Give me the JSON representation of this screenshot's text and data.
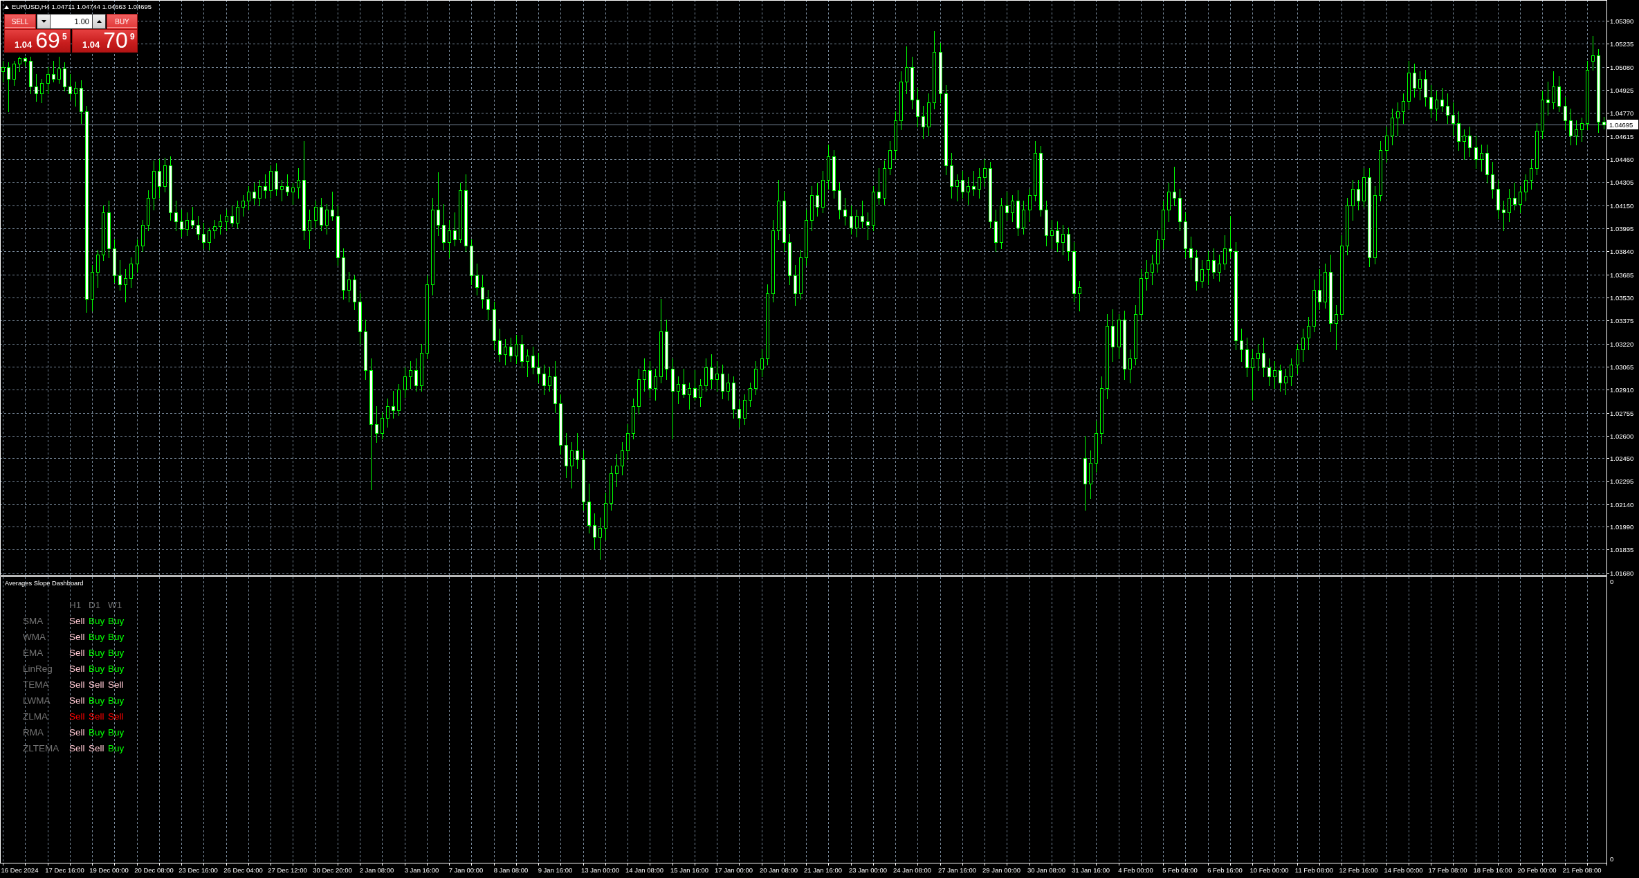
{
  "chart_header": {
    "symbol": "EURUSD,H4",
    "prices": [
      "1.04711",
      "1.04744",
      "1.04663",
      "1.04695"
    ]
  },
  "trade_panel": {
    "sell": {
      "label": "SELL",
      "big_figure": "1.04",
      "pips": "69",
      "fraction": "5"
    },
    "volume": "1.00",
    "buy": {
      "label": "BUY",
      "big_figure": "1.04",
      "pips": "70",
      "fraction": "9"
    }
  },
  "chart_data": [
    {
      "type": "candlestick",
      "color": "#00ff00",
      "grid": true,
      "ylim": [
        1.0166,
        1.0553
      ],
      "yticks": [
        {
          "value": 1.0539,
          "label": "1.05390"
        },
        {
          "value": 1.05235,
          "label": "1.05235"
        },
        {
          "value": 1.0508,
          "label": "1.05080"
        },
        {
          "value": 1.04925,
          "label": "1.04925"
        },
        {
          "value": 1.0477,
          "label": "1.04770"
        },
        {
          "value": 1.04615,
          "label": "1.04615"
        },
        {
          "value": 1.0446,
          "label": "1.04460"
        },
        {
          "value": 1.04305,
          "label": "1.04305"
        },
        {
          "value": 1.0415,
          "label": "1.04150"
        },
        {
          "value": 1.03995,
          "label": "1.03995"
        },
        {
          "value": 1.0384,
          "label": "1.03840"
        },
        {
          "value": 1.03685,
          "label": "1.03685"
        },
        {
          "value": 1.0353,
          "label": "1.03530"
        },
        {
          "value": 1.03375,
          "label": "1.03375"
        },
        {
          "value": 1.0322,
          "label": "1.03220"
        },
        {
          "value": 1.03065,
          "label": "1.03065"
        },
        {
          "value": 1.0291,
          "label": "1.02910"
        },
        {
          "value": 1.02755,
          "label": "1.02755"
        },
        {
          "value": 1.026,
          "label": "1.02600"
        },
        {
          "value": 1.0245,
          "label": "1.02450"
        },
        {
          "value": 1.02295,
          "label": "1.02295"
        },
        {
          "value": 1.0214,
          "label": "1.02140"
        },
        {
          "value": 1.0199,
          "label": "1.01990"
        },
        {
          "value": 1.01835,
          "label": "1.01835"
        },
        {
          "value": 1.0168,
          "label": "1.01680"
        }
      ],
      "ref_lines": [
        {
          "axis": "y",
          "value": 1.04695,
          "label": "1.04695",
          "color": "#778899"
        }
      ],
      "ohlc": [
        [
          1.0505,
          1.0512,
          1.0498,
          1.0508
        ],
        [
          1.0508,
          1.0511,
          1.0478,
          1.05
        ],
        [
          1.05,
          1.0512,
          1.0496,
          1.051
        ],
        [
          1.051,
          1.0515,
          1.0505,
          1.0514
        ],
        [
          1.0514,
          1.0515,
          1.0509,
          1.0512
        ],
        [
          1.0512,
          1.0515,
          1.049,
          1.0495
        ],
        [
          1.0495,
          1.0503,
          1.0485,
          1.049
        ],
        [
          1.049,
          1.05,
          1.0484,
          1.0497
        ],
        [
          1.0497,
          1.0508,
          1.049,
          1.0503
        ],
        [
          1.0503,
          1.0512,
          1.0498,
          1.05
        ],
        [
          1.05,
          1.0515,
          1.0497,
          1.0507
        ],
        [
          1.0507,
          1.0511,
          1.0492,
          1.0495
        ],
        [
          1.0495,
          1.0503,
          1.0486,
          1.049
        ],
        [
          1.049,
          1.0498,
          1.0482,
          1.0494
        ],
        [
          1.0494,
          1.0499,
          1.047,
          1.0478
        ],
        [
          1.0478,
          1.0482,
          1.0343,
          1.0352
        ],
        [
          1.0352,
          1.0375,
          1.0344,
          1.037
        ],
        [
          1.037,
          1.0385,
          1.036,
          1.0382
        ],
        [
          1.0382,
          1.0415,
          1.0378,
          1.041
        ],
        [
          1.041,
          1.0418,
          1.038,
          1.0386
        ],
        [
          1.0386,
          1.0392,
          1.0363,
          1.0368
        ],
        [
          1.0368,
          1.0378,
          1.0358,
          1.0362
        ],
        [
          1.0362,
          1.0372,
          1.035,
          1.0366
        ],
        [
          1.0366,
          1.038,
          1.036,
          1.0376
        ],
        [
          1.0376,
          1.0392,
          1.037,
          1.0388
        ],
        [
          1.0388,
          1.0405,
          1.0384,
          1.0402
        ],
        [
          1.0402,
          1.0425,
          1.0398,
          1.042
        ],
        [
          1.042,
          1.0445,
          1.0412,
          1.0438
        ],
        [
          1.0438,
          1.0446,
          1.042,
          1.0428
        ],
        [
          1.0428,
          1.0447,
          1.0424,
          1.0442
        ],
        [
          1.0442,
          1.0448,
          1.0405,
          1.041
        ],
        [
          1.041,
          1.0418,
          1.0398,
          1.0404
        ],
        [
          1.0404,
          1.0412,
          1.0394,
          1.0399
        ],
        [
          1.0399,
          1.041,
          1.0395,
          1.0405
        ],
        [
          1.0405,
          1.0414,
          1.04,
          1.0402
        ],
        [
          1.0402,
          1.0408,
          1.0392,
          1.0396
        ],
        [
          1.0396,
          1.0403,
          1.0386,
          1.039
        ],
        [
          1.039,
          1.04,
          1.0385,
          1.0398
        ],
        [
          1.0398,
          1.0405,
          1.0393,
          1.0401
        ],
        [
          1.0401,
          1.0409,
          1.0396,
          1.0404
        ],
        [
          1.0404,
          1.0412,
          1.0398,
          1.0408
        ],
        [
          1.0408,
          1.0415,
          1.0401,
          1.0403
        ],
        [
          1.0403,
          1.0418,
          1.04,
          1.0414
        ],
        [
          1.0414,
          1.0422,
          1.0408,
          1.0418
        ],
        [
          1.0418,
          1.0428,
          1.0412,
          1.0424
        ],
        [
          1.0424,
          1.043,
          1.0416,
          1.042
        ],
        [
          1.042,
          1.0432,
          1.0415,
          1.0428
        ],
        [
          1.0428,
          1.0436,
          1.042,
          1.0425
        ],
        [
          1.0425,
          1.0442,
          1.042,
          1.0438
        ],
        [
          1.0438,
          1.0443,
          1.0422,
          1.0426
        ],
        [
          1.0426,
          1.0432,
          1.0418,
          1.0428
        ],
        [
          1.0428,
          1.0436,
          1.0422,
          1.0424
        ],
        [
          1.0424,
          1.043,
          1.0416,
          1.0427
        ],
        [
          1.0427,
          1.044,
          1.042,
          1.0432
        ],
        [
          1.0432,
          1.0458,
          1.0392,
          1.0398
        ],
        [
          1.0398,
          1.0412,
          1.0386,
          1.0405
        ],
        [
          1.0405,
          1.0418,
          1.04,
          1.0414
        ],
        [
          1.0414,
          1.042,
          1.0398,
          1.0402
        ],
        [
          1.0402,
          1.0416,
          1.0396,
          1.0412
        ],
        [
          1.0412,
          1.0424,
          1.0405,
          1.0408
        ],
        [
          1.0408,
          1.0415,
          1.0375,
          1.038
        ],
        [
          1.038,
          1.0386,
          1.0352,
          1.0358
        ],
        [
          1.0358,
          1.037,
          1.035,
          1.0365
        ],
        [
          1.0365,
          1.0368,
          1.0345,
          1.035
        ],
        [
          1.035,
          1.0356,
          1.0322,
          1.033
        ],
        [
          1.033,
          1.0338,
          1.0298,
          1.0304
        ],
        [
          1.0304,
          1.0312,
          1.0224,
          1.0268
        ],
        [
          1.0268,
          1.028,
          1.0256,
          1.0262
        ],
        [
          1.0262,
          1.0276,
          1.0258,
          1.0272
        ],
        [
          1.0272,
          1.0285,
          1.0266,
          1.028
        ],
        [
          1.028,
          1.029,
          1.0272,
          1.0277
        ],
        [
          1.0277,
          1.0295,
          1.0274,
          1.0291
        ],
        [
          1.0291,
          1.0306,
          1.0286,
          1.03
        ],
        [
          1.03,
          1.031,
          1.0292,
          1.0304
        ],
        [
          1.0304,
          1.0312,
          1.029,
          1.0294
        ],
        [
          1.0294,
          1.0322,
          1.029,
          1.0316
        ],
        [
          1.0316,
          1.0368,
          1.0312,
          1.0362
        ],
        [
          1.0362,
          1.042,
          1.0355,
          1.0412
        ],
        [
          1.0412,
          1.0437,
          1.0395,
          1.0402
        ],
        [
          1.0402,
          1.0416,
          1.0385,
          1.039
        ],
        [
          1.039,
          1.0405,
          1.038,
          1.0398
        ],
        [
          1.0398,
          1.041,
          1.0388,
          1.0392
        ],
        [
          1.0392,
          1.043,
          1.039,
          1.0425
        ],
        [
          1.0425,
          1.0436,
          1.0384,
          1.0388
        ],
        [
          1.0388,
          1.0392,
          1.0362,
          1.0368
        ],
        [
          1.0368,
          1.0376,
          1.0355,
          1.036
        ],
        [
          1.036,
          1.0368,
          1.0346,
          1.0352
        ],
        [
          1.0352,
          1.0358,
          1.0338,
          1.0345
        ],
        [
          1.0345,
          1.035,
          1.0318,
          1.0324
        ],
        [
          1.0324,
          1.0332,
          1.031,
          1.0315
        ],
        [
          1.0315,
          1.0325,
          1.0308,
          1.032
        ],
        [
          1.032,
          1.0326,
          1.031,
          1.0314
        ],
        [
          1.0314,
          1.0328,
          1.0309,
          1.0322
        ],
        [
          1.0322,
          1.0328,
          1.0306,
          1.031
        ],
        [
          1.031,
          1.0318,
          1.03,
          1.0314
        ],
        [
          1.0314,
          1.032,
          1.0302,
          1.0306
        ],
        [
          1.0306,
          1.0316,
          1.0296,
          1.0302
        ],
        [
          1.0302,
          1.0308,
          1.0288,
          1.0294
        ],
        [
          1.0294,
          1.0306,
          1.029,
          1.03
        ],
        [
          1.03,
          1.031,
          1.0276,
          1.0282
        ],
        [
          1.0282,
          1.0288,
          1.0248,
          1.0254
        ],
        [
          1.0254,
          1.0262,
          1.0232,
          1.024
        ],
        [
          1.024,
          1.0256,
          1.0225,
          1.025
        ],
        [
          1.025,
          1.0262,
          1.0238,
          1.0244
        ],
        [
          1.0244,
          1.025,
          1.021,
          1.0216
        ],
        [
          1.0216,
          1.0228,
          1.0195,
          1.02
        ],
        [
          1.02,
          1.0208,
          1.0184,
          1.0192
        ],
        [
          1.0192,
          1.0205,
          1.0177,
          1.0198
        ],
        [
          1.0198,
          1.0222,
          1.019,
          1.0215
        ],
        [
          1.0215,
          1.024,
          1.021,
          1.0235
        ],
        [
          1.0235,
          1.0248,
          1.0226,
          1.024
        ],
        [
          1.024,
          1.0256,
          1.0234,
          1.025
        ],
        [
          1.025,
          1.0268,
          1.0244,
          1.0262
        ],
        [
          1.0262,
          1.0285,
          1.0258,
          1.028
        ],
        [
          1.028,
          1.0305,
          1.0275,
          1.0298
        ],
        [
          1.0298,
          1.0312,
          1.029,
          1.0304
        ],
        [
          1.0304,
          1.031,
          1.0286,
          1.0292
        ],
        [
          1.0292,
          1.0305,
          1.0284,
          1.03
        ],
        [
          1.03,
          1.0352,
          1.0296,
          1.033
        ],
        [
          1.033,
          1.0338,
          1.0298,
          1.0305
        ],
        [
          1.0305,
          1.0312,
          1.0258,
          1.029
        ],
        [
          1.029,
          1.03,
          1.0282,
          1.0295
        ],
        [
          1.0295,
          1.0305,
          1.0286,
          1.0288
        ],
        [
          1.0288,
          1.0296,
          1.0278,
          1.0292
        ],
        [
          1.0292,
          1.0304,
          1.0284,
          1.0286
        ],
        [
          1.0286,
          1.0298,
          1.028,
          1.0294
        ],
        [
          1.0294,
          1.0312,
          1.029,
          1.0306
        ],
        [
          1.0306,
          1.0315,
          1.0292,
          1.0298
        ],
        [
          1.0298,
          1.031,
          1.029,
          1.0302
        ],
        [
          1.0302,
          1.0308,
          1.0285,
          1.029
        ],
        [
          1.029,
          1.0302,
          1.0284,
          1.0296
        ],
        [
          1.0296,
          1.03,
          1.0272,
          1.0278
        ],
        [
          1.0278,
          1.0284,
          1.0266,
          1.0272
        ],
        [
          1.0272,
          1.0288,
          1.0268,
          1.0284
        ],
        [
          1.0284,
          1.0296,
          1.028,
          1.0292
        ],
        [
          1.0292,
          1.031,
          1.0288,
          1.0305
        ],
        [
          1.0305,
          1.0318,
          1.03,
          1.0312
        ],
        [
          1.0312,
          1.0362,
          1.0308,
          1.0356
        ],
        [
          1.0356,
          1.0405,
          1.035,
          1.0398
        ],
        [
          1.0398,
          1.0432,
          1.0392,
          1.0418
        ],
        [
          1.0418,
          1.0424,
          1.0384,
          1.039
        ],
        [
          1.039,
          1.0396,
          1.0362,
          1.0368
        ],
        [
          1.0368,
          1.0375,
          1.0348,
          1.0356
        ],
        [
          1.0356,
          1.0385,
          1.0352,
          1.038
        ],
        [
          1.038,
          1.0412,
          1.0375,
          1.0405
        ],
        [
          1.0405,
          1.0428,
          1.0398,
          1.0422
        ],
        [
          1.0422,
          1.043,
          1.0408,
          1.0414
        ],
        [
          1.0414,
          1.0438,
          1.041,
          1.0432
        ],
        [
          1.0432,
          1.0456,
          1.0426,
          1.0448
        ],
        [
          1.0448,
          1.0452,
          1.042,
          1.0425
        ],
        [
          1.0425,
          1.043,
          1.0406,
          1.0412
        ],
        [
          1.0412,
          1.042,
          1.0402,
          1.0408
        ],
        [
          1.0408,
          1.0415,
          1.0396,
          1.04
        ],
        [
          1.04,
          1.0412,
          1.0394,
          1.0408
        ],
        [
          1.0408,
          1.0418,
          1.04,
          1.0404
        ],
        [
          1.0404,
          1.041,
          1.0392,
          1.0402
        ],
        [
          1.0402,
          1.0428,
          1.0398,
          1.0424
        ],
        [
          1.0424,
          1.044,
          1.0416,
          1.042
        ],
        [
          1.042,
          1.0445,
          1.0416,
          1.044
        ],
        [
          1.044,
          1.0458,
          1.0436,
          1.0452
        ],
        [
          1.0452,
          1.0478,
          1.0446,
          1.0472
        ],
        [
          1.0472,
          1.0505,
          1.0466,
          1.0498
        ],
        [
          1.0498,
          1.0522,
          1.049,
          1.0508
        ],
        [
          1.0508,
          1.0515,
          1.048,
          1.0486
        ],
        [
          1.0486,
          1.0494,
          1.0468,
          1.0475
        ],
        [
          1.0475,
          1.0482,
          1.046,
          1.0468
        ],
        [
          1.0468,
          1.049,
          1.0462,
          1.0484
        ],
        [
          1.0484,
          1.0532,
          1.048,
          1.0518
        ],
        [
          1.0518,
          1.0524,
          1.0484,
          1.049
        ],
        [
          1.049,
          1.0496,
          1.0436,
          1.0442
        ],
        [
          1.0442,
          1.045,
          1.042,
          1.0428
        ],
        [
          1.0428,
          1.0436,
          1.0418,
          1.0432
        ],
        [
          1.0432,
          1.0438,
          1.042,
          1.0424
        ],
        [
          1.0424,
          1.0434,
          1.0416,
          1.0428
        ],
        [
          1.0428,
          1.0438,
          1.0422,
          1.0426
        ],
        [
          1.0426,
          1.044,
          1.042,
          1.0434
        ],
        [
          1.0434,
          1.0446,
          1.0428,
          1.044
        ],
        [
          1.044,
          1.0444,
          1.04,
          1.0404
        ],
        [
          1.0404,
          1.0412,
          1.0384,
          1.039
        ],
        [
          1.039,
          1.042,
          1.0386,
          1.0415
        ],
        [
          1.0415,
          1.0424,
          1.0405,
          1.041
        ],
        [
          1.041,
          1.0422,
          1.0404,
          1.0418
        ],
        [
          1.0418,
          1.0425,
          1.0395,
          1.04
        ],
        [
          1.04,
          1.0418,
          1.0396,
          1.0412
        ],
        [
          1.0412,
          1.0426,
          1.0404,
          1.0422
        ],
        [
          1.0422,
          1.0458,
          1.0418,
          1.045
        ],
        [
          1.045,
          1.0455,
          1.0408,
          1.0412
        ],
        [
          1.0412,
          1.0418,
          1.0388,
          1.0395
        ],
        [
          1.0395,
          1.0405,
          1.0386,
          1.0398
        ],
        [
          1.0398,
          1.0404,
          1.0384,
          1.039
        ],
        [
          1.039,
          1.0402,
          1.0382,
          1.0396
        ],
        [
          1.0396,
          1.04,
          1.0378,
          1.0384
        ],
        [
          1.0384,
          1.039,
          1.035,
          1.0356
        ],
        [
          1.0356,
          1.0364,
          1.0344,
          1.036
        ],
        [
          1.0245,
          1.026,
          1.021,
          1.0228
        ],
        [
          1.0228,
          1.025,
          1.0218,
          1.0242
        ],
        [
          1.0242,
          1.027,
          1.0236,
          1.0262
        ],
        [
          1.0262,
          1.03,
          1.0255,
          1.0292
        ],
        [
          1.0292,
          1.0342,
          1.0285,
          1.0334
        ],
        [
          1.0334,
          1.0345,
          1.031,
          1.032
        ],
        [
          1.032,
          1.0342,
          1.0312,
          1.0338
        ],
        [
          1.0338,
          1.0344,
          1.0298,
          1.0305
        ],
        [
          1.0305,
          1.0318,
          1.0296,
          1.0312
        ],
        [
          1.0312,
          1.0348,
          1.0308,
          1.0342
        ],
        [
          1.0342,
          1.0372,
          1.0338,
          1.0366
        ],
        [
          1.0366,
          1.0378,
          1.0358,
          1.037
        ],
        [
          1.037,
          1.0382,
          1.0362,
          1.0376
        ],
        [
          1.0376,
          1.0398,
          1.037,
          1.0392
        ],
        [
          1.0392,
          1.0418,
          1.0386,
          1.0412
        ],
        [
          1.0412,
          1.043,
          1.0404,
          1.0424
        ],
        [
          1.0424,
          1.0441,
          1.0415,
          1.042
        ],
        [
          1.042,
          1.0426,
          1.0398,
          1.0404
        ],
        [
          1.0404,
          1.041,
          1.038,
          1.0386
        ],
        [
          1.0386,
          1.0394,
          1.0372,
          1.038
        ],
        [
          1.038,
          1.0385,
          1.0358,
          1.0364
        ],
        [
          1.0364,
          1.0378,
          1.036,
          1.0372
        ],
        [
          1.0372,
          1.0384,
          1.0362,
          1.0378
        ],
        [
          1.0378,
          1.0386,
          1.0366,
          1.037
        ],
        [
          1.037,
          1.0382,
          1.0364,
          1.0376
        ],
        [
          1.0376,
          1.0395,
          1.0372,
          1.0386
        ],
        [
          1.0386,
          1.0408,
          1.038,
          1.0384
        ],
        [
          1.0384,
          1.039,
          1.0318,
          1.0324
        ],
        [
          1.0324,
          1.0332,
          1.031,
          1.0318
        ],
        [
          1.0318,
          1.0326,
          1.03,
          1.0306
        ],
        [
          1.0306,
          1.0318,
          1.0284,
          1.0312
        ],
        [
          1.0312,
          1.0322,
          1.0304,
          1.0316
        ],
        [
          1.0316,
          1.0326,
          1.03,
          1.0306
        ],
        [
          1.0306,
          1.0312,
          1.0294,
          1.03
        ],
        [
          1.03,
          1.031,
          1.0292,
          1.0304
        ],
        [
          1.0304,
          1.0308,
          1.029,
          1.0296
        ],
        [
          1.0296,
          1.0305,
          1.0288,
          1.03
        ],
        [
          1.03,
          1.0312,
          1.0294,
          1.0308
        ],
        [
          1.0308,
          1.0322,
          1.0302,
          1.0318
        ],
        [
          1.0318,
          1.0332,
          1.031,
          1.0326
        ],
        [
          1.0326,
          1.034,
          1.0318,
          1.0334
        ],
        [
          1.0334,
          1.0365,
          1.033,
          1.0358
        ],
        [
          1.0358,
          1.0372,
          1.0345,
          1.035
        ],
        [
          1.035,
          1.0376,
          1.0346,
          1.037
        ],
        [
          1.037,
          1.0382,
          1.033,
          1.0336
        ],
        [
          1.0336,
          1.0348,
          1.0318,
          1.0342
        ],
        [
          1.0342,
          1.0395,
          1.0338,
          1.0388
        ],
        [
          1.0388,
          1.042,
          1.0382,
          1.0415
        ],
        [
          1.0415,
          1.0432,
          1.0405,
          1.0426
        ],
        [
          1.0426,
          1.0432,
          1.0412,
          1.0418
        ],
        [
          1.0418,
          1.044,
          1.0414,
          1.0434
        ],
        [
          1.0434,
          1.044,
          1.0374,
          1.038
        ],
        [
          1.038,
          1.0428,
          1.0376,
          1.0422
        ],
        [
          1.0422,
          1.0458,
          1.0418,
          1.0452
        ],
        [
          1.0452,
          1.0468,
          1.0444,
          1.0462
        ],
        [
          1.0462,
          1.048,
          1.0456,
          1.0474
        ],
        [
          1.0474,
          1.0484,
          1.0462,
          1.0478
        ],
        [
          1.0478,
          1.049,
          1.047,
          1.0485
        ],
        [
          1.0485,
          1.0512,
          1.048,
          1.0504
        ],
        [
          1.0504,
          1.051,
          1.0488,
          1.0494
        ],
        [
          1.0494,
          1.0505,
          1.0486,
          1.05
        ],
        [
          1.05,
          1.0506,
          1.0482,
          1.0488
        ],
        [
          1.0488,
          1.0496,
          1.0474,
          1.048
        ],
        [
          1.048,
          1.0492,
          1.0472,
          1.0486
        ],
        [
          1.0486,
          1.0494,
          1.0478,
          1.0482
        ],
        [
          1.0482,
          1.049,
          1.047,
          1.0476
        ],
        [
          1.0476,
          1.0484,
          1.0462,
          1.047
        ],
        [
          1.047,
          1.0478,
          1.0452,
          1.0458
        ],
        [
          1.0458,
          1.0466,
          1.0446,
          1.0462
        ],
        [
          1.0462,
          1.0468,
          1.0448,
          1.0454
        ],
        [
          1.0454,
          1.0462,
          1.044,
          1.0446
        ],
        [
          1.0446,
          1.0456,
          1.0438,
          1.045
        ],
        [
          1.045,
          1.0456,
          1.043,
          1.0436
        ],
        [
          1.0436,
          1.0444,
          1.042,
          1.0426
        ],
        [
          1.0426,
          1.0432,
          1.0406,
          1.0412
        ],
        [
          1.0412,
          1.0418,
          1.0398,
          1.041
        ],
        [
          1.041,
          1.0426,
          1.0404,
          1.042
        ],
        [
          1.042,
          1.043,
          1.0412,
          1.0416
        ],
        [
          1.0416,
          1.0428,
          1.041,
          1.0424
        ],
        [
          1.0424,
          1.0436,
          1.0418,
          1.0432
        ],
        [
          1.0432,
          1.0446,
          1.0426,
          1.044
        ],
        [
          1.044,
          1.047,
          1.0436,
          1.0465
        ],
        [
          1.0465,
          1.0492,
          1.046,
          1.0486
        ],
        [
          1.0486,
          1.0498,
          1.0476,
          1.0484
        ],
        [
          1.0484,
          1.0505,
          1.048,
          1.0495
        ],
        [
          1.0495,
          1.0502,
          1.0478,
          1.0482
        ],
        [
          1.0482,
          1.0488,
          1.0466,
          1.0472
        ],
        [
          1.0472,
          1.048,
          1.0456,
          1.0462
        ],
        [
          1.0462,
          1.0472,
          1.0456,
          1.0466
        ],
        [
          1.0466,
          1.0474,
          1.0458,
          1.047
        ],
        [
          1.047,
          1.0512,
          1.0466,
          1.0506
        ],
        [
          1.0512,
          1.0529,
          1.0506,
          1.0516
        ],
        [
          1.0516,
          1.052,
          1.0464,
          1.0471
        ],
        [
          1.04711,
          1.04744,
          1.04663,
          1.04695
        ]
      ]
    },
    {
      "type": "other",
      "title": "Averages Slope Dashboard",
      "categories": [
        null,
        null,
        null,
        "16 Dec 2024",
        null,
        null,
        null,
        null,
        null,
        null,
        null,
        "17 Dec 16:00",
        null,
        null,
        null,
        null,
        null,
        null,
        null,
        "19 Dec 00:00",
        null,
        null,
        null,
        null,
        null,
        null,
        null,
        "20 Dec 08:00",
        null,
        null,
        null,
        null,
        null,
        null,
        null,
        "23 Dec 16:00",
        null,
        null,
        null,
        null,
        null,
        null,
        null,
        "26 Dec 04:00",
        null,
        null,
        null,
        null,
        null,
        null,
        null,
        "27 Dec 12:00",
        null,
        null,
        null,
        null,
        null,
        null,
        null,
        "30 Dec 20:00",
        null,
        null,
        null,
        null,
        null,
        null,
        null,
        "2 Jan 08:00",
        null,
        null,
        null,
        null,
        null,
        null,
        null,
        "3 Jan 16:00",
        null,
        null,
        null,
        null,
        null,
        null,
        null,
        "7 Jan 00:00",
        null,
        null,
        null,
        null,
        null,
        null,
        null,
        "8 Jan 08:00",
        null,
        null,
        null,
        null,
        null,
        null,
        null,
        "9 Jan 16:00",
        null,
        null,
        null,
        null,
        null,
        null,
        null,
        "13 Jan 00:00",
        null,
        null,
        null,
        null,
        null,
        null,
        null,
        "14 Jan 08:00",
        null,
        null,
        null,
        null,
        null,
        null,
        null,
        "15 Jan 16:00",
        null,
        null,
        null,
        null,
        null,
        null,
        null,
        "17 Jan 00:00",
        null,
        null,
        null,
        null,
        null,
        null,
        null,
        "20 Jan 08:00",
        null,
        null,
        null,
        null,
        null,
        null,
        null,
        "21 Jan 16:00",
        null,
        null,
        null,
        null,
        null,
        null,
        null,
        "23 Jan 00:00",
        null,
        null,
        null,
        null,
        null,
        null,
        null,
        "24 Jan 08:00",
        null,
        null,
        null,
        null,
        null,
        null,
        null,
        "27 Jan 16:00",
        null,
        null,
        null,
        null,
        null,
        null,
        null,
        "29 Jan 00:00",
        null,
        null,
        null,
        null,
        null,
        null,
        null,
        "30 Jan 08:00",
        null,
        null,
        null,
        null,
        null,
        null,
        null,
        "31 Jan 16:00",
        null,
        null,
        null,
        null,
        null,
        null,
        null,
        "4 Feb 00:00",
        null,
        null,
        null,
        null,
        null,
        null,
        null,
        "5 Feb 08:00",
        null,
        null,
        null,
        null,
        null,
        null,
        null,
        "6 Feb 16:00",
        null,
        null,
        null,
        null,
        null,
        null,
        null,
        "10 Feb 00:00",
        null,
        null,
        null,
        null,
        null,
        null,
        null,
        "11 Feb 08:00",
        null,
        null,
        null,
        null,
        null,
        null,
        null,
        "12 Feb 16:00",
        null,
        null,
        null,
        null,
        null,
        null,
        null,
        "14 Feb 00:00",
        null,
        null,
        null,
        null,
        null,
        null,
        null,
        "17 Feb 08:00",
        null,
        null,
        null,
        null,
        null,
        null,
        null,
        "18 Feb 16:00",
        null,
        null,
        null,
        null,
        null,
        null,
        null,
        "20 Feb 00:00",
        null,
        null,
        null,
        null,
        null,
        null,
        null,
        "21 Feb 08:00",
        null,
        null,
        null,
        null
      ]
    }
  ],
  "indicator_pane": {
    "scale_labels": [
      "0",
      "0"
    ],
    "dashboard": {
      "columns": [
        "H1",
        "D1",
        "W1"
      ],
      "rows": [
        {
          "name": "SMA",
          "signals": [
            {
              "text": "Sell",
              "color": "#ffc8d2"
            },
            {
              "text": "Buy",
              "color": "#00ff00"
            },
            {
              "text": "Buy",
              "color": "#00ff00"
            }
          ]
        },
        {
          "name": "WMA",
          "signals": [
            {
              "text": "Sell",
              "color": "#ffc8d2"
            },
            {
              "text": "Buy",
              "color": "#00ff00"
            },
            {
              "text": "Buy",
              "color": "#00ff00"
            }
          ]
        },
        {
          "name": "EMA",
          "signals": [
            {
              "text": "Sell",
              "color": "#ffc8d2"
            },
            {
              "text": "Buy",
              "color": "#00ff00"
            },
            {
              "text": "Buy",
              "color": "#00ff00"
            }
          ]
        },
        {
          "name": "LinReg",
          "signals": [
            {
              "text": "Sell",
              "color": "#ffc8d2"
            },
            {
              "text": "Buy",
              "color": "#00ff00"
            },
            {
              "text": "Buy",
              "color": "#00ff00"
            }
          ]
        },
        {
          "name": "TEMA",
          "signals": [
            {
              "text": "Sell",
              "color": "#ffc8d2"
            },
            {
              "text": "Sell",
              "color": "#ffc8d2"
            },
            {
              "text": "Sell",
              "color": "#ffc8d2"
            }
          ]
        },
        {
          "name": "LWMA",
          "signals": [
            {
              "text": "Sell",
              "color": "#ffc8d2"
            },
            {
              "text": "Buy",
              "color": "#00ff00"
            },
            {
              "text": "Buy",
              "color": "#00ff00"
            }
          ]
        },
        {
          "name": "ZLMA",
          "signals": [
            {
              "text": "Sell",
              "color": "#ff0000"
            },
            {
              "text": "Sell",
              "color": "#ff0000"
            },
            {
              "text": "Sell",
              "color": "#ff0000"
            }
          ]
        },
        {
          "name": "RMA",
          "signals": [
            {
              "text": "Sell",
              "color": "#ffc8d2"
            },
            {
              "text": "Buy",
              "color": "#00ff00"
            },
            {
              "text": "Buy",
              "color": "#00ff00"
            }
          ]
        },
        {
          "name": "ZLTEMA",
          "signals": [
            {
              "text": "Sell",
              "color": "#ffc8d2"
            },
            {
              "text": "Sell",
              "color": "#ffc8d2"
            },
            {
              "text": "Buy",
              "color": "#00ff00"
            }
          ]
        }
      ]
    }
  }
}
